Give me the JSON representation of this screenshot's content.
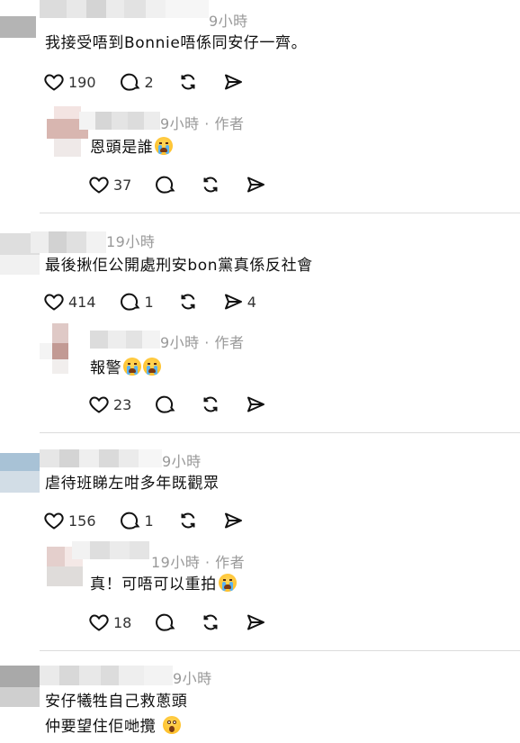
{
  "threads": [
    {
      "comment": {
        "time": "9小時",
        "text": "我接受唔到Bonnie唔係同安仔一齊。",
        "likes": "190",
        "replies": "2",
        "reposts": "",
        "shares": ""
      },
      "reply": {
        "time": "9小時 · 作者",
        "text": "恩頭是誰",
        "emoji": "loudly-crying-face",
        "likes": "37"
      }
    },
    {
      "comment": {
        "time": "19小時",
        "text": "最後揪佢公開處刑安bon黨真係反社會",
        "likes": "414",
        "replies": "1",
        "reposts": "",
        "shares": "4"
      },
      "reply": {
        "time": "9小時 · 作者",
        "text": "報警",
        "emoji": "loudly-crying-face",
        "likes": "23"
      }
    },
    {
      "comment": {
        "time": "9小時",
        "text": "虐待班睇左咁多年既觀眾",
        "likes": "156",
        "replies": "1",
        "reposts": "",
        "shares": ""
      },
      "reply": {
        "time": "19小時 · 作者",
        "text": "真！可唔可以重拍",
        "emoji": "loudly-crying-face",
        "likes": "18"
      }
    },
    {
      "comment": {
        "time": "9小時",
        "line1": "安仔犧牲自己救蔥頭",
        "line2": "仲要望住佢哋攬",
        "emoji": "face-screaming-in-fear"
      }
    }
  ],
  "icons": {
    "like": "heart-icon",
    "reply": "comment-bubble-icon",
    "repost": "repost-icon",
    "share": "send-icon"
  },
  "colors": {
    "text": "#101010",
    "meta": "#999999",
    "divider": "#dcdcdc"
  }
}
